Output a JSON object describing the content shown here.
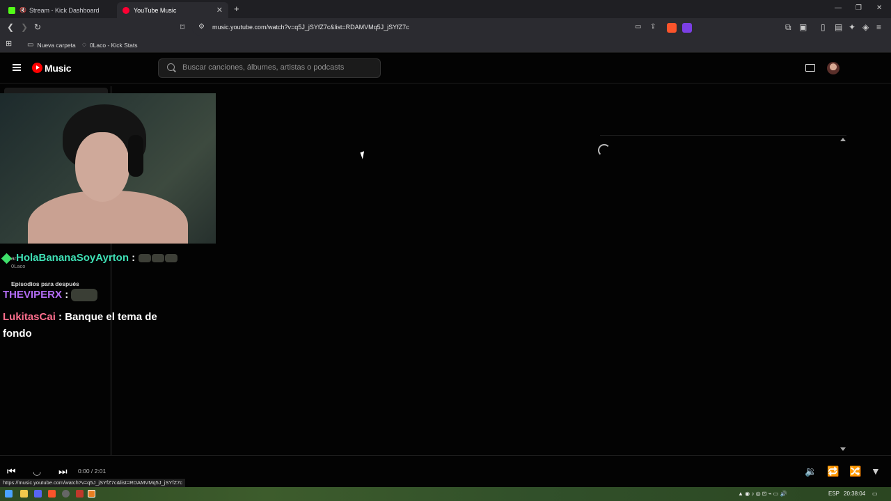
{
  "browser": {
    "tabs": [
      {
        "title": "Stream - Kick Dashboard",
        "muted": true,
        "active": false,
        "favicon_color": "#53fc18"
      },
      {
        "title": "YouTube Music",
        "muted": false,
        "active": true,
        "favicon_color": "#ff0033"
      }
    ],
    "new_tab": "+",
    "url": "music.youtube.com/watch?v=q5J_jSYfZ7c&list=RDAMVMq5J_jSYfZ7c",
    "bookmarks": [
      {
        "label": "Nueva carpeta",
        "icon": "folder-icon"
      },
      {
        "label": "0Laco - Kick Stats",
        "icon": "stats-icon"
      }
    ],
    "status_url": "https://music.youtube.com/watch?v=q5J_jSYfZ7c&list=RDAMVMq5J_jSYfZ7c",
    "extension_badge": "1"
  },
  "ytmusic": {
    "logo_text": "Music",
    "search_placeholder": "Buscar canciones, álbumes, artistas o podcasts",
    "accent": "#ff0000"
  },
  "chat": [
    {
      "user": "HolaBananaSoyAyrton",
      "message": "",
      "emotes": 3,
      "color": "#3fe0b5",
      "badge": "diamond"
    },
    {
      "user": "THEVIPERX",
      "message": "",
      "emotes": 1,
      "color": "#b36cf5"
    },
    {
      "user": "LukitasCai",
      "message": "Banque el tema de fondo",
      "emotes": 0,
      "color": "#ff6f8e"
    }
  ],
  "sidebar_remnants": {
    "channel": "0Laco",
    "section": "Episodios para después",
    "fragment": "ar"
  },
  "player": {
    "time": "0:00 / 2:01"
  },
  "taskbar": {
    "language": "ESP",
    "clock": "20:38:04"
  }
}
